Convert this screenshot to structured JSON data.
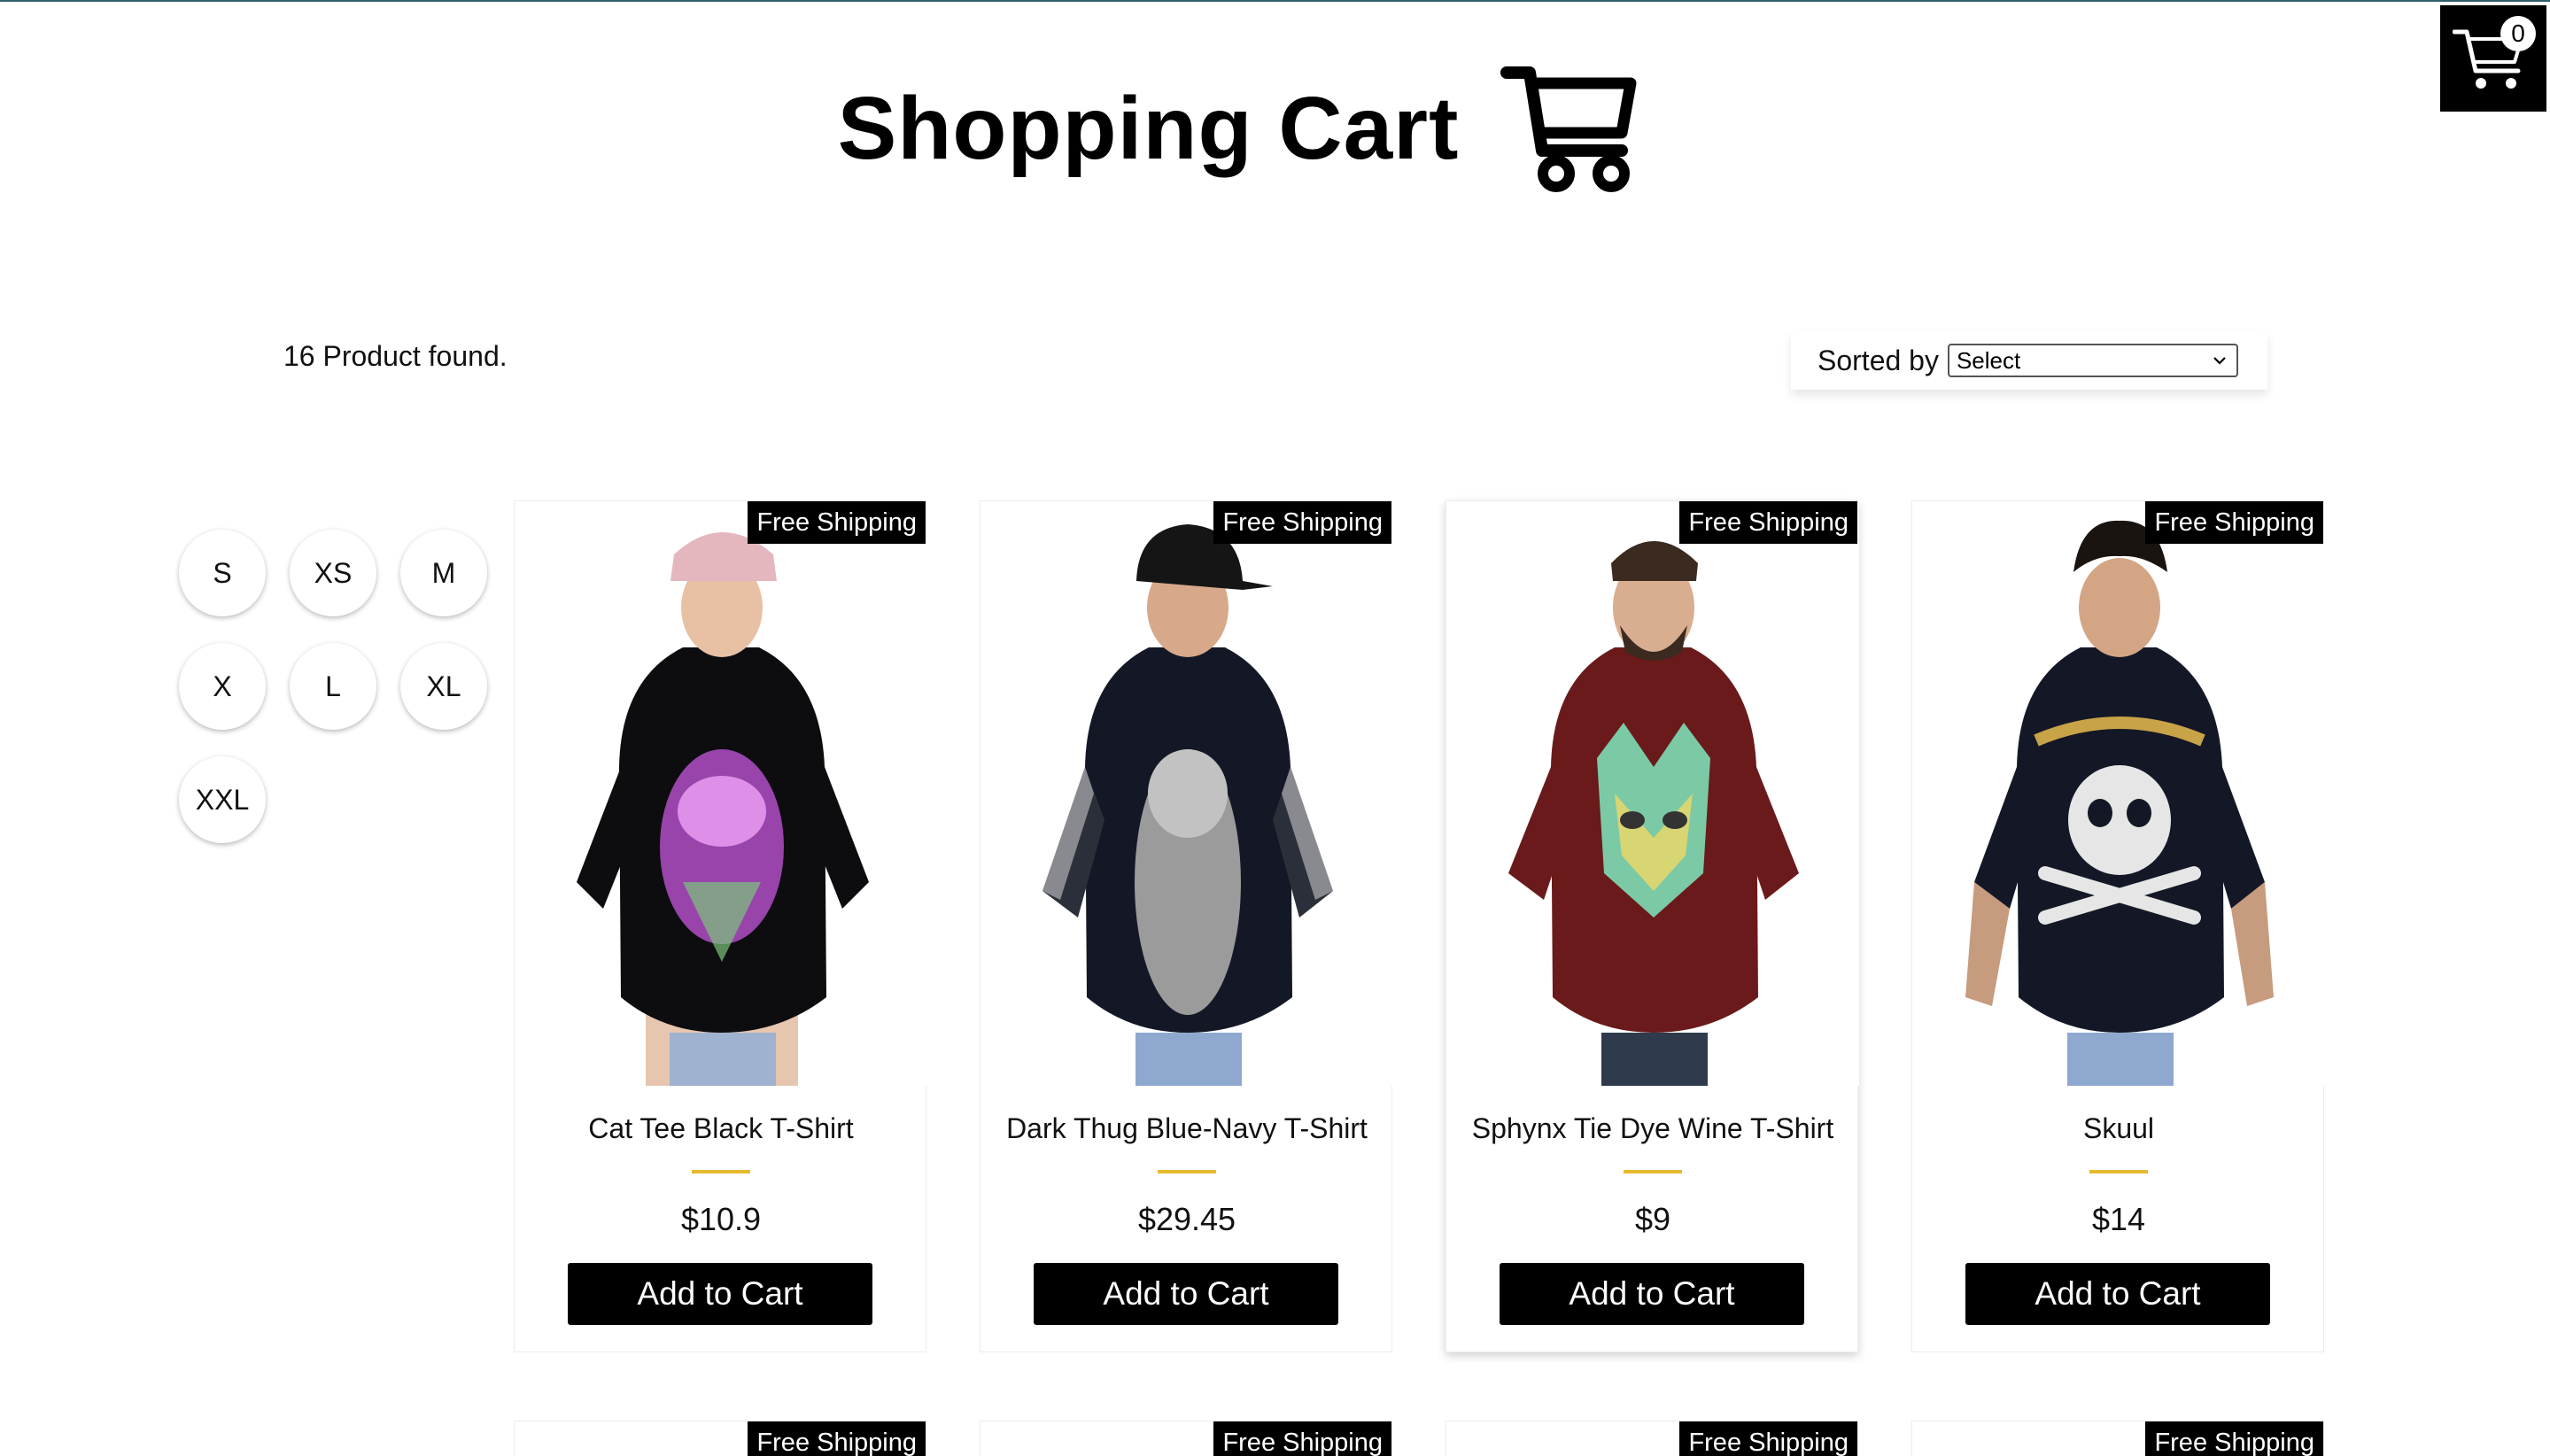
{
  "header": {
    "title": "Shopping Cart"
  },
  "cart": {
    "count": "0"
  },
  "results": {
    "found_text": "16 Product found."
  },
  "sort": {
    "label": "Sorted by",
    "selected": "Select"
  },
  "sizes": [
    "S",
    "XS",
    "M",
    "X",
    "L",
    "XL",
    "XXL"
  ],
  "products": [
    {
      "badge": "Free Shipping",
      "title": "Cat Tee Black T-Shirt",
      "price": "$10.9",
      "button": "Add to Cart",
      "shirt_color": "#0d0d10",
      "print": "cat"
    },
    {
      "badge": "Free Shipping",
      "title": "Dark Thug Blue-Navy T-Shirt",
      "price": "$29.45",
      "button": "Add to Cart",
      "shirt_color": "#141826",
      "print": "bandana"
    },
    {
      "badge": "Free Shipping",
      "title": "Sphynx Tie Dye Wine T-Shirt",
      "price": "$9",
      "button": "Add to Cart",
      "shirt_color": "#6a1a1a",
      "print": "sphynx"
    },
    {
      "badge": "Free Shipping",
      "title": "Skuul",
      "price": "$14",
      "button": "Add to Cart",
      "shirt_color": "#141826",
      "print": "skull"
    }
  ],
  "second_row": [
    {
      "badge": "Free Shipping"
    },
    {
      "badge": "Free Shipping"
    },
    {
      "badge": "Free Shipping"
    },
    {
      "badge": "Free Shipping"
    }
  ],
  "colors": {
    "accent_bar": "#e8b92d",
    "button_bg": "#000000",
    "badge_bg": "#000000"
  }
}
